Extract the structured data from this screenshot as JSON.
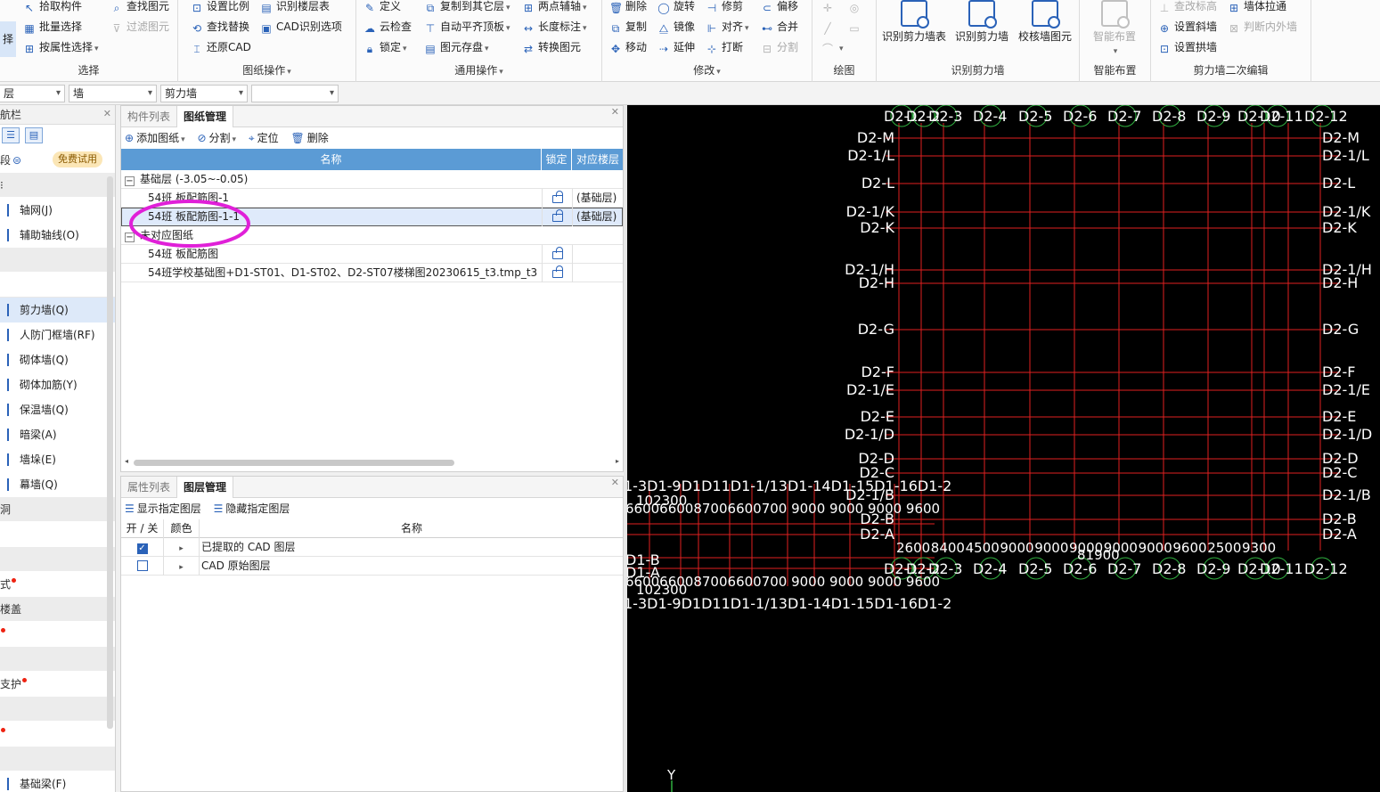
{
  "ribbon": {
    "select_group": {
      "title": "选择",
      "big_label": "择",
      "items": [
        "拾取构件",
        "批量选择",
        "按属性选择"
      ],
      "items2": [
        "查找图元",
        "过滤图元"
      ]
    },
    "drawing_group": {
      "title": "图纸操作",
      "items": [
        "设置比例",
        "查找替换",
        "还原CAD"
      ],
      "items2": [
        "识别楼层表",
        "CAD识别选项"
      ]
    },
    "general_group": {
      "title": "通用操作",
      "items": [
        "定义",
        "云检查",
        "锁定"
      ],
      "items2": [
        "复制到其它层",
        "自动平齐顶板",
        "图元存盘"
      ],
      "items3": [
        "两点辅轴",
        "长度标注",
        "转换图元"
      ]
    },
    "modify_group": {
      "title": "修改",
      "items": [
        "删除",
        "复制",
        "移动"
      ],
      "items2": [
        "旋转",
        "镜像",
        "延伸"
      ],
      "items3": [
        "修剪",
        "对齐",
        "打断"
      ],
      "items4": [
        "偏移",
        "合并",
        "分割"
      ]
    },
    "draw_group": {
      "title": "绘图"
    },
    "recognize_group": {
      "title": "识别剪力墙",
      "buttons": [
        "识别剪力墙表",
        "识别剪力墙",
        "校核墙图元"
      ]
    },
    "smart_group": {
      "title": "智能布置",
      "button": "智能布置"
    },
    "edit2_group": {
      "title": "剪力墙二次编辑",
      "items": [
        "查改标高",
        "设置斜墙",
        "设置拱墙"
      ],
      "items2": [
        "墙体拉通",
        "判断内外墙"
      ]
    }
  },
  "filters": [
    "层",
    "墙",
    "剪力墙",
    ""
  ],
  "leftnav": {
    "title": "航栏",
    "segment_label": "段",
    "trial_badge": "免费试用",
    "items": [
      {
        "label": "轴网(J)",
        "selected": false
      },
      {
        "label": "辅助轴线(O)",
        "selected": false
      },
      {
        "label": "剪力墙(Q)",
        "selected": true
      },
      {
        "label": "人防门框墙(RF)",
        "selected": false
      },
      {
        "label": "砌体墙(Q)",
        "selected": false
      },
      {
        "label": "砌体加筋(Y)",
        "selected": false
      },
      {
        "label": "保温墙(Q)",
        "selected": false
      },
      {
        "label": "暗梁(A)",
        "selected": false
      },
      {
        "label": "墙垛(E)",
        "selected": false
      },
      {
        "label": "幕墙(Q)",
        "selected": false
      }
    ],
    "section_door": "洞",
    "section_style": "式",
    "section_floor": "楼盖",
    "section_support": "支护",
    "last_item": "基础梁(F)"
  },
  "drawing_panel": {
    "tabs": [
      "构件列表",
      "图纸管理"
    ],
    "active_tab": "图纸管理",
    "toolbar": [
      "添加图纸",
      "分割",
      "定位",
      "删除"
    ],
    "columns": [
      "名称",
      "锁定",
      "对应楼层"
    ],
    "groups": [
      {
        "name": "基础层 (-3.05~-0.05)",
        "rows": [
          {
            "name": "54班 板配筋图-1",
            "floor": "(基础层)",
            "selected": false
          },
          {
            "name": "54班 板配筋图-1-1",
            "floor": "(基础层)",
            "selected": true
          }
        ]
      },
      {
        "name": "未对应图纸",
        "rows": [
          {
            "name": "54班 板配筋图",
            "floor": "",
            "selected": false
          },
          {
            "name": "54班学校基础图+D1-ST01、D1-ST02、D2-ST07楼梯图20230615_t3.tmp_t3",
            "floor": "",
            "selected": false
          }
        ]
      }
    ]
  },
  "layer_panel": {
    "tabs": [
      "属性列表",
      "图层管理"
    ],
    "active_tab": "图层管理",
    "toolbar": [
      "显示指定图层",
      "隐藏指定图层"
    ],
    "columns": [
      "开 / 关",
      "颜色",
      "名称"
    ],
    "rows": [
      {
        "name": "已提取的 CAD 图层",
        "on": true
      },
      {
        "name": "CAD 原始图层",
        "on": false
      }
    ]
  },
  "cad": {
    "top_axis_labels": [
      "D2-1",
      "D2-2",
      "D2-3",
      "D2-4",
      "D2-5",
      "D2-6",
      "D2-7",
      "D2-8",
      "D2-9",
      "D2-10",
      "D2-11",
      "D2-12"
    ],
    "left_axis_labels": [
      "D2-M",
      "D2-1/L",
      "D2-L",
      "D2-1/K",
      "D2-K",
      "D2-1/H",
      "D2-H",
      "D2-G",
      "D2-F",
      "D2-1/E",
      "D2-E",
      "D2-1/D",
      "D2-D",
      "D2-C",
      "D2-1/B",
      "D2-B",
      "D2-A"
    ],
    "dims_bottom": [
      "2600",
      "8400",
      "4500",
      "9000",
      "9000",
      "9000",
      "9000",
      "9000",
      "9600",
      "2500",
      "9300"
    ],
    "total_dim": "81900",
    "d1_row_labels": "1-3D1-9D1D11D1-1/13D1-14D1-15D1-16D1-2",
    "d1_dims": "6600660087006600700 9000 9000 9000 9600",
    "d1_total": "102300",
    "d1_left": [
      "D1-B",
      "D1-A"
    ],
    "axis_y": "Y",
    "colors": {
      "grid": "#e02020",
      "text": "#ffffff",
      "bubble": "#30b040",
      "bg": "#000000"
    }
  }
}
